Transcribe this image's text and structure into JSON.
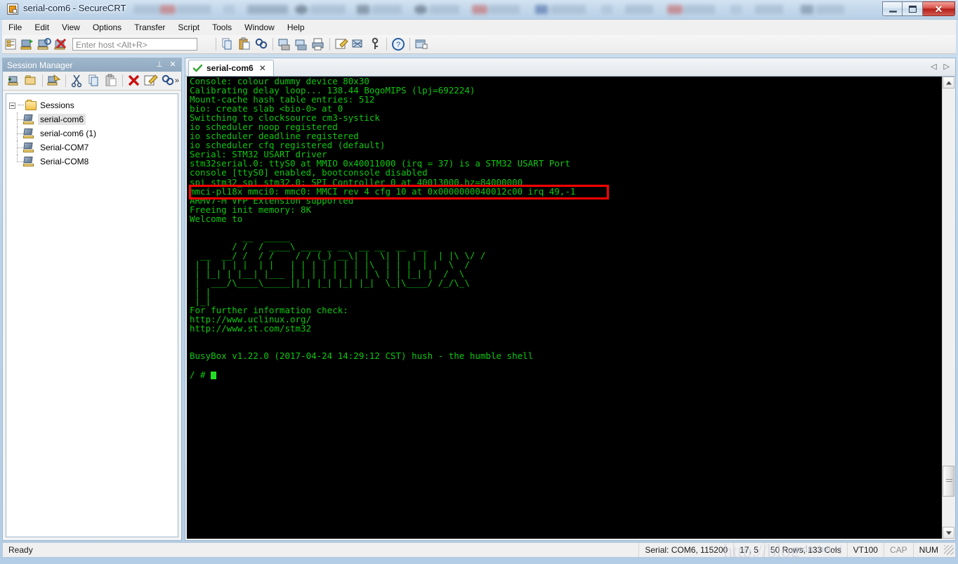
{
  "window": {
    "title": "serial-com6 - SecureCRT",
    "app_icon": "securecrt-icon",
    "minimize_label": "",
    "maximize_label": "",
    "close_label": "✕"
  },
  "menubar": {
    "items": [
      "File",
      "Edit",
      "View",
      "Options",
      "Transfer",
      "Script",
      "Tools",
      "Window",
      "Help"
    ]
  },
  "toolbar": {
    "host_placeholder": "Enter host <Alt+R>",
    "host_value": "",
    "icons_left": [
      "session-manager-icon",
      "connect-icon",
      "connect-local-shell-icon",
      "disconnect-icon"
    ],
    "icons_right": [
      "copy-icon",
      "paste-icon",
      "find-icon",
      "print-screen-icon",
      "log-session-icon",
      "print-icon",
      "session-options-icon",
      "clear-screen-icon",
      "key-icon",
      "help-icon",
      "new-window-icon"
    ]
  },
  "session_manager": {
    "title": "Session Manager",
    "pin_glyph": "⊥",
    "close_glyph": "✕",
    "toolbar_icons": [
      "new-session-icon",
      "new-folder-icon",
      "connect-session-icon",
      "cut-icon",
      "copy-icon",
      "paste-icon",
      "delete-icon",
      "properties-icon",
      "find-icon",
      "more-icon"
    ],
    "root_label": "Sessions",
    "sessions": [
      {
        "label": "serial-com6",
        "selected": true
      },
      {
        "label": "serial-com6 (1)",
        "selected": false
      },
      {
        "label": "Serial-COM7",
        "selected": false
      },
      {
        "label": "Serial-COM8",
        "selected": false
      }
    ]
  },
  "tabs": {
    "active": {
      "label": "serial-com6",
      "status_icon": "connected-check-icon",
      "close_glyph": "✕"
    },
    "nav_prev": "◁",
    "nav_next": "▷"
  },
  "terminal": {
    "foreground": "#0ec70e",
    "background": "#000000",
    "annotation_color": "#ff0000",
    "lines": [
      "Console: colour dummy device 80x30",
      "Calibrating delay loop... 138.44 BogoMIPS (lpj=692224)",
      "Mount-cache hash table entries: 512",
      "bio: create slab <bio-0> at 0",
      "Switching to clocksource cm3-systick",
      "io scheduler noop registered",
      "io scheduler deadline registered",
      "io scheduler cfq registered (default)",
      "Serial: STM32 USART driver",
      "stm32serial.0: ttyS0 at MMIO 0x40011000 (irq = 37) is a STM32 USART Port",
      "console [ttyS0] enabled, bootconsole disabled",
      "spi stm32_spi stm32.0: SPI Controller 0 at 40013000.hz=84000000",
      "mmci-pl18x mmci0: mmc0: MMCI rev 4 cfg 10 at 0x0000000040012c00 irq 49,-1",
      "ARMv7-M VFP Extension supported",
      "Freeing init memory: 8K",
      "Welcome to",
      "",
      "          __  _____",
      "        / /  / ____\\ ____ _ __  __ __  __  __",
      "  __  __/ /  / /    / / (_) __\\| |  \\| |  | |  | |\\ \\/ /",
      " | |  | | |  | |   | | | | | | | |\\  | | |  | |  \\  /",
      " | |_| | |__| |___ | | | | | | | | \\ | | |_| |  /  \\",
      " |  ___/\\____\\_____||_| |_| |_| |_|  \\_|\\____/ /_/\\_\\",
      " | |",
      " |_|",
      "For further information check:",
      "http://www.uclinux.org/",
      "http://www.st.com/stm32",
      "",
      "",
      "BusyBox v1.22.0 (2017-04-24 14:29:12 CST) hush - the humble shell",
      "",
      "/ # "
    ],
    "highlighted_line_index": 12,
    "prompt": "/ # ",
    "cursor": "block"
  },
  "statusbar": {
    "left_text": "Ready",
    "connection": "Serial: COM6, 115200",
    "position": "17,  5",
    "dimensions": "50 Rows, 133 Cols",
    "emulation": "VT100",
    "caps": "CAP",
    "num": "NUM"
  },
  "watermark": {
    "text_small": "csdn. net / j",
    "text_large": "http://blog"
  }
}
